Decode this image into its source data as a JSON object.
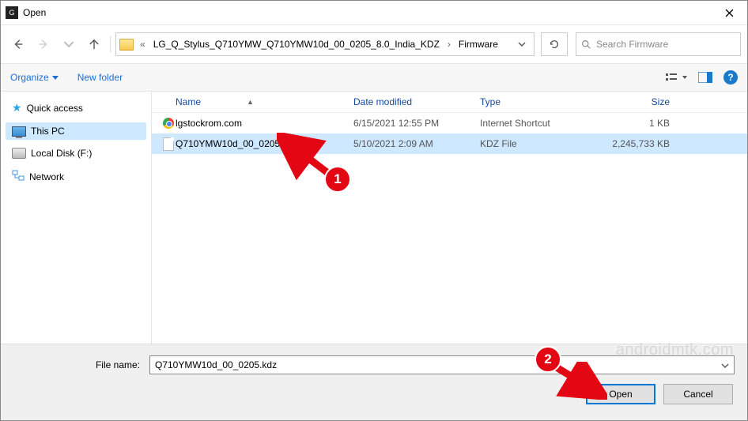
{
  "window": {
    "title": "Open"
  },
  "nav": {
    "breadcrumb_prefix": "«",
    "crumb1": "LG_Q_Stylus_Q710YMW_Q710YMW10d_00_0205_8.0_India_KDZ",
    "crumb2": "Firmware",
    "search_placeholder": "Search Firmware"
  },
  "toolbar": {
    "organize": "Organize",
    "new_folder": "New folder"
  },
  "sidebar": {
    "items": [
      {
        "label": "Quick access"
      },
      {
        "label": "This PC"
      },
      {
        "label": "Local Disk (F:)"
      },
      {
        "label": "Network"
      }
    ]
  },
  "columns": {
    "name": "Name",
    "date": "Date modified",
    "type": "Type",
    "size": "Size"
  },
  "files": [
    {
      "name": "lgstockrom.com",
      "date": "6/15/2021 12:55 PM",
      "type": "Internet Shortcut",
      "size": "1 KB"
    },
    {
      "name": "Q710YMW10d_00_0205.kdz",
      "date": "5/10/2021 2:09 AM",
      "type": "KDZ File",
      "size": "2,245,733 KB"
    }
  ],
  "footer": {
    "label": "File name:",
    "value": "Q710YMW10d_00_0205.kdz",
    "open": "Open",
    "cancel": "Cancel"
  },
  "annotations": {
    "one": "1",
    "two": "2"
  },
  "watermark": "androidmtk.com"
}
